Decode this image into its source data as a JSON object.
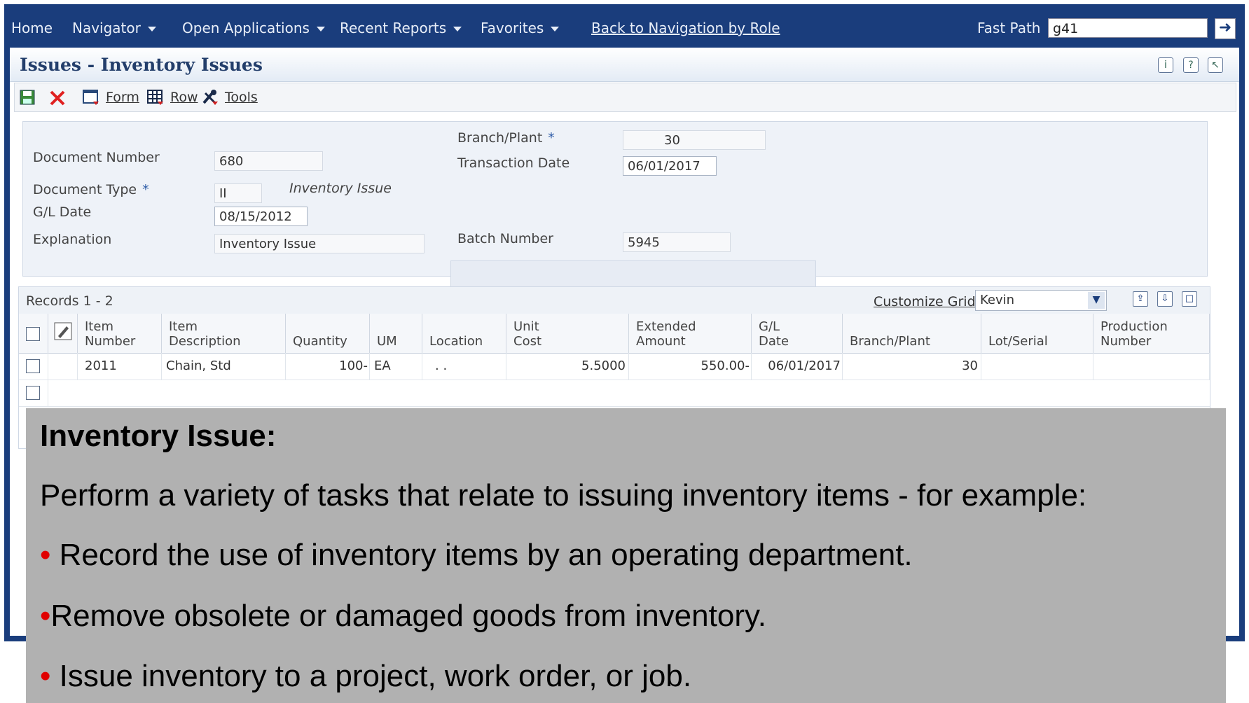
{
  "nav": {
    "home": "Home",
    "navigator": "Navigator",
    "open_applications": "Open Applications",
    "recent_reports": "Recent Reports",
    "favorites": "Favorites",
    "back_link": "Back to Navigation by Role",
    "fast_path_label": "Fast Path",
    "fast_path_value": "g41",
    "go_icon": "arrow-right-icon"
  },
  "page": {
    "title": "Issues - Inventory Issues",
    "help_icons": [
      "info-icon",
      "help-icon",
      "context-help-icon"
    ]
  },
  "toolbar": {
    "form": "Form",
    "row": "Row",
    "tools": "Tools"
  },
  "form": {
    "document_number_label": "Document Number",
    "document_number": "680",
    "document_type_label": "Document Type",
    "document_type": "II",
    "document_type_desc": "Inventory Issue",
    "gl_date_label": "G/L Date",
    "gl_date": "08/15/2012",
    "explanation_label": "Explanation",
    "explanation": "Inventory Issue",
    "branch_plant_label": "Branch/Plant",
    "branch_plant": "30",
    "transaction_date_label": "Transaction Date",
    "transaction_date": "06/01/2017",
    "batch_number_label": "Batch Number",
    "batch_number": "5945",
    "required_marker": "*"
  },
  "grid": {
    "records": "Records  1 - 2",
    "customize": "Customize Grid",
    "view": "Kevin",
    "columns": [
      {
        "l1": "Item",
        "l2": "Number"
      },
      {
        "l1": "Item",
        "l2": "Description"
      },
      {
        "l1": "",
        "l2": "Quantity"
      },
      {
        "l1": "",
        "l2": "UM"
      },
      {
        "l1": "",
        "l2": "Location"
      },
      {
        "l1": "Unit",
        "l2": "Cost"
      },
      {
        "l1": "Extended",
        "l2": "Amount"
      },
      {
        "l1": "G/L",
        "l2": "Date"
      },
      {
        "l1": "",
        "l2": "Branch/Plant"
      },
      {
        "l1": "",
        "l2": "Lot/Serial"
      },
      {
        "l1": "Production",
        "l2": "Number"
      }
    ],
    "row1": {
      "item_number": "2011",
      "description": "Chain, Std",
      "quantity": "100-",
      "um": "EA",
      "location": ".  .",
      "unit_cost": "5.5000",
      "extended_amount": "550.00-",
      "gl_date": "06/01/2017",
      "branch_plant": "30",
      "lot_serial": "",
      "production_number": ""
    }
  },
  "overlay": {
    "title": "Inventory Issue:",
    "intro": "Perform a variety of tasks that relate to issuing inventory items - for example:",
    "bullet_char": "•",
    "b1": "Record the use of inventory items by an operating department.",
    "b2": "Remove obsolete or damaged goods from inventory.",
    "b3": "Issue inventory to a project, work order, or job."
  },
  "colors": {
    "nav_bg": "#1a3d7c",
    "overlay_bg": "#b1b1b1",
    "bullet": "#e00000"
  }
}
